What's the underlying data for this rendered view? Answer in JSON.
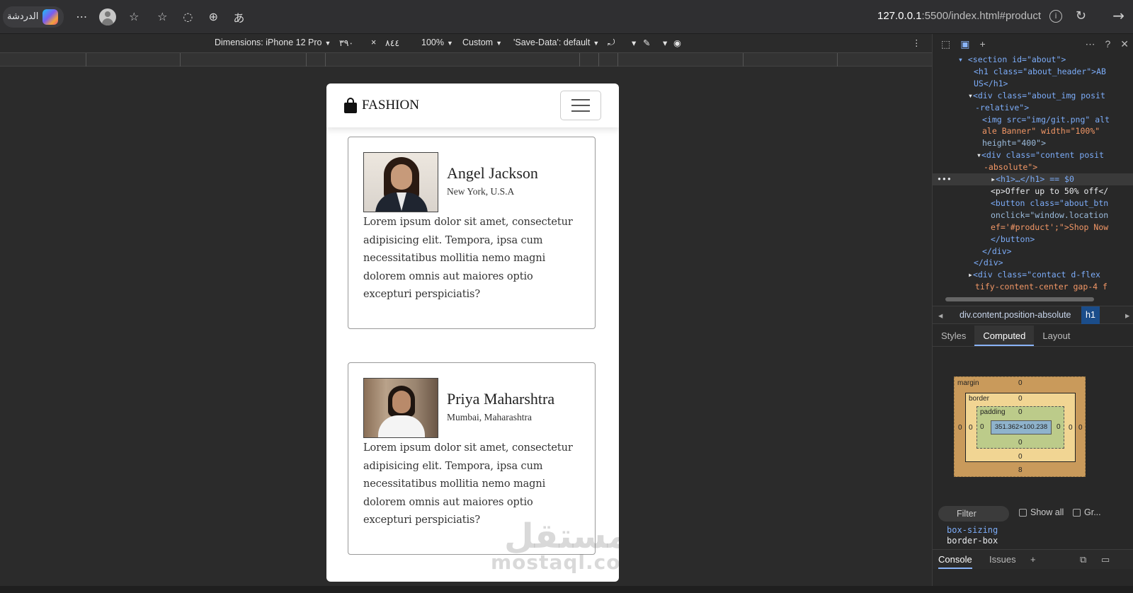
{
  "browser": {
    "copilot_label": "الدردشة",
    "url_host": "127.0.0.1",
    "url_path": ":5500/index.html#product"
  },
  "device_toolbar": {
    "dimensions": "Dimensions: iPhone 12 Pro",
    "width": "٣٩٠",
    "times": "×",
    "height": "٨٤٤",
    "zoom": "100%",
    "throttle": "Custom",
    "save_data": "'Save-Data': default"
  },
  "page": {
    "brand": "FASHION",
    "cards": [
      {
        "name": "Angel Jackson",
        "location": "New York, U.S.A",
        "text": "Lorem ipsum dolor sit amet, consectetur adipisicing elit. Tempora, ipsa cum necessitatibus mollitia nemo magni dolorem omnis aut maiores optio excepturi perspiciatis?"
      },
      {
        "name": "Priya Maharshtra",
        "location": "Mumbai, Maharashtra",
        "text": "Lorem ipsum dolor sit amet, consectetur adipisicing elit. Tempora, ipsa cum necessitatibus mollitia nemo magni dolorem omnis aut maiores optio excepturi perspiciatis?"
      }
    ],
    "watermark_ar": "مستقل",
    "watermark_en": "mostaql.com"
  },
  "devtools": {
    "dom_lines": [
      "<section id=\"about\">",
      "<h1 class=\"about_header\">AB",
      "US</h1>",
      "<div class=\"about_img posit",
      "-relative\">",
      "<img src=\"img/git.png\" alt",
      "ale Banner\" width=\"100%\"",
      "height=\"400\">",
      "<div class=\"content posit",
      "-absolute\">",
      "<h1>…</h1> == $0",
      "<p>Offer up to 50% off</",
      "<button class=\"about_btn",
      "onclick=\"window.location",
      "ef='#product';\">Shop Now",
      "</button>",
      "</div>",
      "</div>",
      "<div class=\"contact d-flex",
      "tify-content-center gap-4 f"
    ],
    "breadcrumb": "div.content.position-absolute",
    "breadcrumb_tag": "h1",
    "tabs": [
      "Styles",
      "Computed",
      "Layout"
    ],
    "box_model": {
      "margin_label": "margin",
      "border_label": "border",
      "padding_label": "padding",
      "content_size": "351.362×100.238",
      "margin_top": "0",
      "margin_bottom": "8",
      "margin_left": "0",
      "margin_right": "0",
      "border_top": "0",
      "border_bottom": "0",
      "border_left": "0",
      "border_right": "0",
      "padding_top": "0",
      "padding_bottom": "0",
      "padding_left": "0",
      "padding_right": "0"
    },
    "filter_placeholder": "Filter",
    "show_all": "Show all",
    "group": "Gr...",
    "computed_prop": "box-sizing",
    "computed_value": "border-box",
    "console_tabs": [
      "Console",
      "Issues"
    ]
  }
}
